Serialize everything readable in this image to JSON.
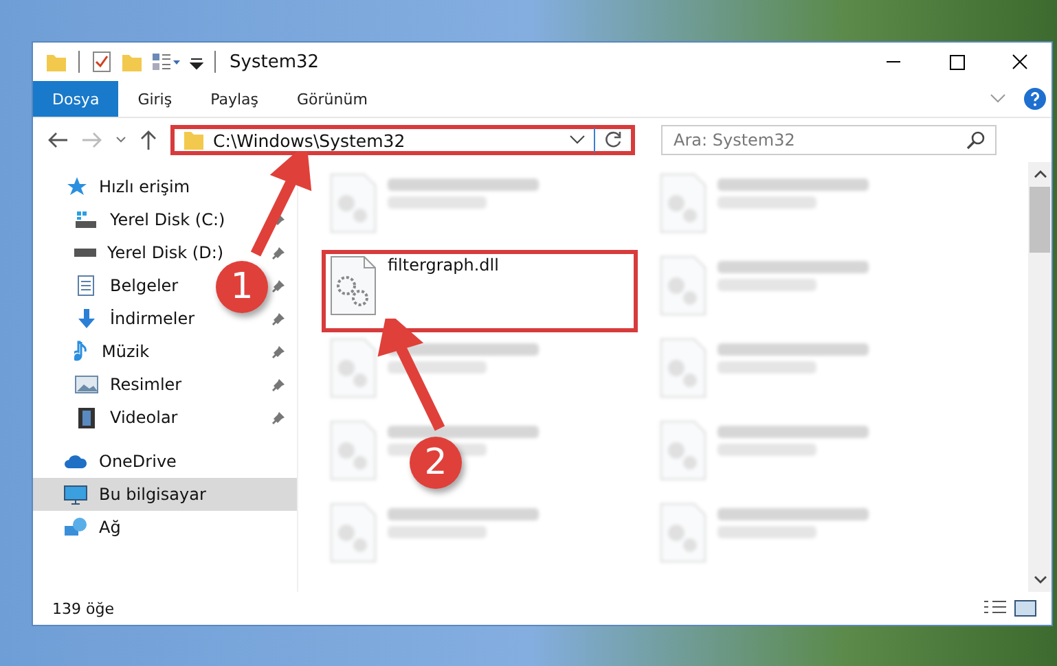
{
  "window": {
    "title": "System32"
  },
  "ribbon_tabs": [
    {
      "label": "Dosya",
      "selected": true
    },
    {
      "label": "Giriş",
      "selected": false
    },
    {
      "label": "Paylaş",
      "selected": false
    },
    {
      "label": "Görünüm",
      "selected": false
    }
  ],
  "address_bar": {
    "path": "C:\\Windows\\System32",
    "highlighted": true
  },
  "search": {
    "placeholder": "Ara: System32"
  },
  "sidebar": {
    "items": [
      {
        "label": "Hızlı erişim",
        "kind": "star",
        "pinned": false,
        "selected": false,
        "children": [
          {
            "label": "Yerel Disk (C:)",
            "kind": "disk-c",
            "pinned": true,
            "selected": false
          },
          {
            "label": "Yerel Disk (D:)",
            "kind": "disk",
            "pinned": true,
            "selected": false
          },
          {
            "label": "Belgeler",
            "kind": "docs",
            "pinned": true,
            "selected": false
          },
          {
            "label": "İndirmeler",
            "kind": "download",
            "pinned": true,
            "selected": false
          },
          {
            "label": "Müzik",
            "kind": "music",
            "pinned": true,
            "selected": false
          },
          {
            "label": "Resimler",
            "kind": "pictures",
            "pinned": true,
            "selected": false
          },
          {
            "label": "Videolar",
            "kind": "videos",
            "pinned": true,
            "selected": false
          }
        ]
      },
      {
        "label": "OneDrive",
        "kind": "cloud",
        "pinned": false,
        "selected": false
      },
      {
        "label": "Bu bilgisayar",
        "kind": "computer",
        "pinned": false,
        "selected": true
      },
      {
        "label": "Ağ",
        "kind": "network",
        "pinned": false,
        "selected": false
      }
    ]
  },
  "files": [
    {
      "blurred": true
    },
    {
      "blurred": true
    },
    {
      "name": "filtergraph.dll",
      "blurred": false,
      "highlighted": true
    },
    {
      "blurred": true
    },
    {
      "blurred": true
    },
    {
      "blurred": true
    },
    {
      "blurred": true
    },
    {
      "blurred": true
    },
    {
      "blurred": true
    },
    {
      "blurred": true
    }
  ],
  "status_bar": {
    "item_count": "139 öğe"
  },
  "callouts": [
    {
      "label": "1"
    },
    {
      "label": "2"
    }
  ]
}
